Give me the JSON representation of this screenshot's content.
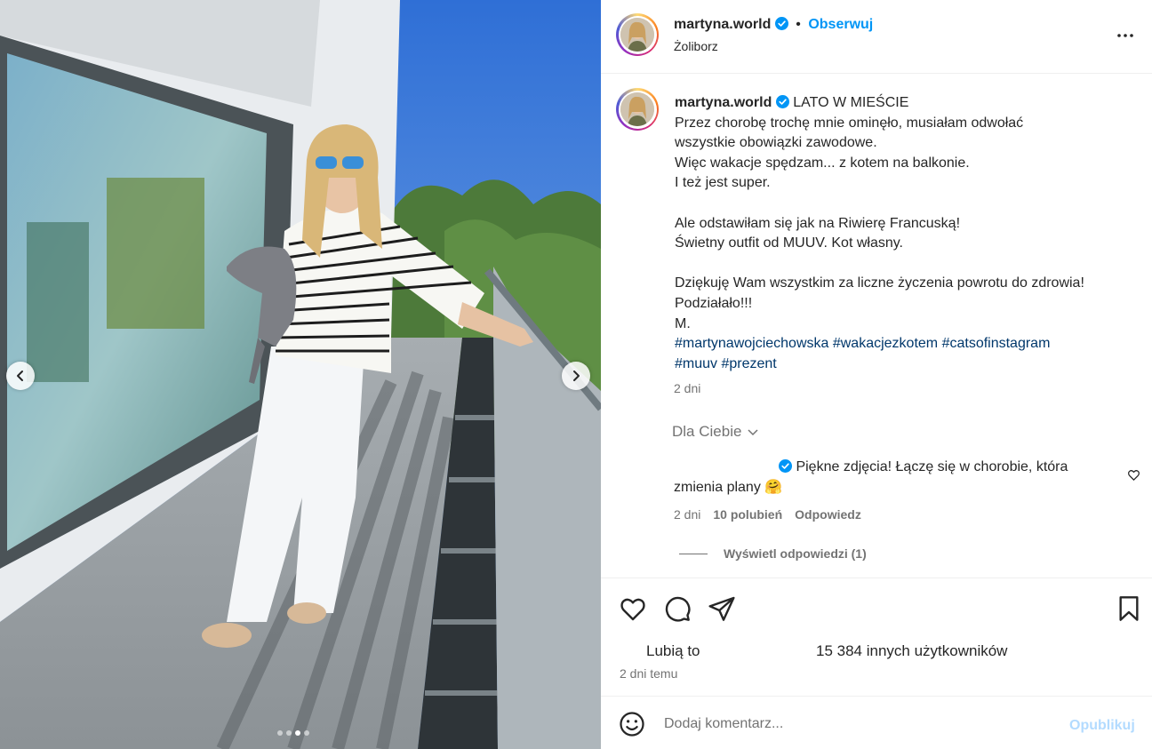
{
  "header": {
    "username": "martyna.world",
    "separator": "•",
    "follow_label": "Obserwuj",
    "location": "Żoliborz"
  },
  "caption": {
    "username": "martyna.world",
    "title": "LATO W MIEŚCIE",
    "lines": [
      "Przez chorobę trochę mnie ominęło, musiałam odwołać",
      "wszystkie obowiązki zawodowe.",
      "Więc wakacje spędzam... z kotem na balkonie.",
      "I też jest super.",
      "",
      "Ale odstawiłam się jak na Riwierę Francuską!",
      "Świetny outfit od MUUV. Kot własny.",
      "",
      "Dziękuję Wam wszystkim za liczne życzenia powrotu do zdrowia!",
      "Podziałało!!!",
      "M."
    ],
    "hashtags_line1": "#martynawojciechowska #wakacjezkotem #catsofinstagram",
    "hashtags_line2": "#muuv #prezent",
    "time": "2 dni"
  },
  "comments_filter": "Dla Ciebie",
  "comment": {
    "text_line1": "Piękne zdjęcia! Łączę się w chorobie, która",
    "text_line2": "zmienia plany",
    "emoji": "🤗",
    "time": "2 dni",
    "likes": "10 polubień",
    "reply_label": "Odpowiedz",
    "view_replies": "Wyświetl odpowiedzi (1)"
  },
  "likes": {
    "prefix": "Lubią to",
    "count": "15 384 innych użytkowników"
  },
  "post_time": "2 dni temu",
  "add_comment": {
    "placeholder": "Dodaj komentarz...",
    "publish_label": "Opublikuj"
  },
  "carousel": {
    "dots": 4,
    "active_index": 2
  },
  "colors": {
    "accent_blue": "#0095f6",
    "hashtag": "#00376b",
    "secondary_text": "#737373",
    "publish_disabled": "#b3dbff"
  },
  "icons": [
    "verified-badge-icon",
    "more-options-icon",
    "heart-icon",
    "comment-icon",
    "share-icon",
    "save-icon",
    "emoji-icon",
    "chevron-down-icon",
    "chevron-left-icon",
    "chevron-right-icon"
  ]
}
